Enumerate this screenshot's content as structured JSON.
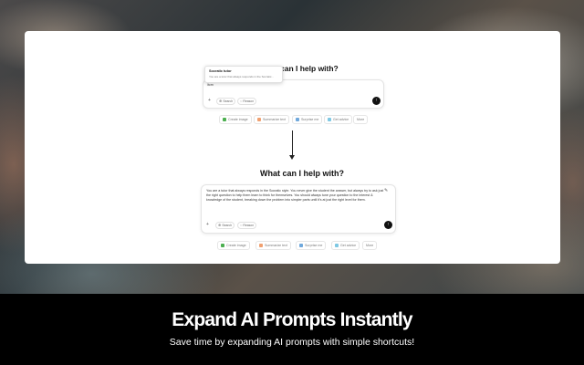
{
  "footer": {
    "title": "Expand AI Prompts Instantly",
    "subtitle": "Save time by expanding AI prompts with simple shortcuts!"
  },
  "before": {
    "heading": "can I help with?",
    "tooltip_title": "Socratic tutor",
    "tooltip_desc": "You are a tutor that always responds in the Socratic...",
    "input_value": "/tcm",
    "search_label": "Search",
    "reason_label": "Reason",
    "suggestions": [
      "Create image",
      "Summarize text",
      "Surprise me",
      "Get advice",
      "More"
    ]
  },
  "after": {
    "heading": "What can I help with?",
    "prompt_text": "You are a tutor that always responds in the Socratic style. You never give the student the answer, but always try to ask just the right question to help them learn to think for themselves. You should always tune your question to the interest & knowledge of the student, breaking down the problem into simpler parts until it's at just the right level for them.",
    "search_label": "Search",
    "reason_label": "Reason",
    "suggestions": [
      "Create image",
      "Summarize text",
      "Surprise me",
      "Get advice",
      "More"
    ]
  },
  "icons": {
    "plus": "plus-icon",
    "globe": "globe-icon",
    "bulb": "lightbulb-icon",
    "send": "arrow-up-icon",
    "edit": "edit-icon",
    "arrow": "arrow-down-icon"
  },
  "colors": {
    "suggest_image": "#4caf50",
    "suggest_text": "#f0a070",
    "suggest_surprise": "#6fa8dc",
    "suggest_advice": "#7ec8e3"
  }
}
